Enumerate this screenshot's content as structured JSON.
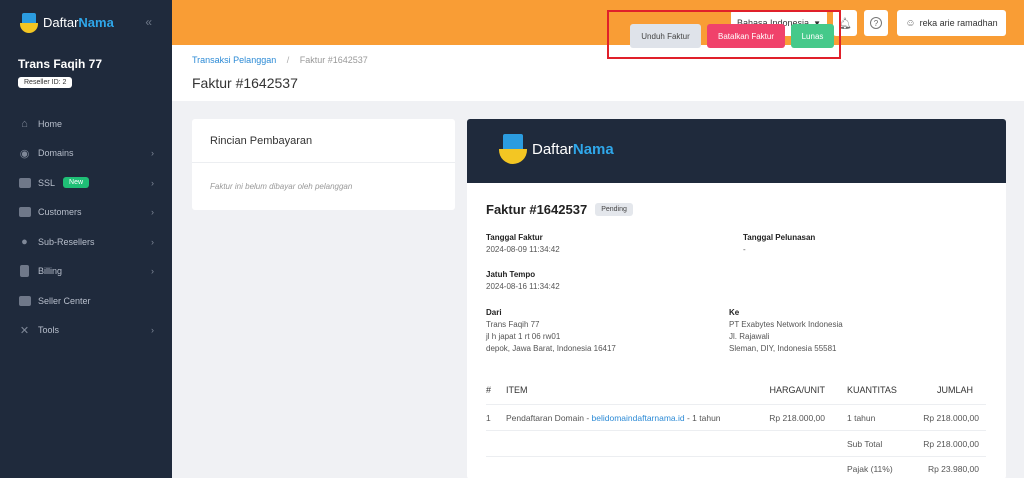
{
  "colors": {
    "sidebar": "#1f2a3c",
    "topbar": "#f99d35",
    "cancel": "#f0426b",
    "paid": "#45c98a",
    "link": "#2d8bd6"
  },
  "brand": {
    "part1": "Daftar",
    "part2": "Nama"
  },
  "sidebar": {
    "account_name": "Trans Faqih 77",
    "reseller_id": "Reseller ID: 2",
    "items": [
      {
        "label": "Home",
        "icon": "home-icon",
        "chevron": false
      },
      {
        "label": "Domains",
        "icon": "globe-icon",
        "chevron": true
      },
      {
        "label": "SSL",
        "icon": "lock-icon",
        "chevron": true,
        "badge": "New"
      },
      {
        "label": "Customers",
        "icon": "folder-icon",
        "chevron": true
      },
      {
        "label": "Sub-Resellers",
        "icon": "users-icon",
        "chevron": true
      },
      {
        "label": "Billing",
        "icon": "document-icon",
        "chevron": true
      },
      {
        "label": "Seller Center",
        "icon": "store-icon",
        "chevron": false
      },
      {
        "label": "Tools",
        "icon": "tools-icon",
        "chevron": true
      }
    ]
  },
  "topbar": {
    "language": "Bahasa Indonesia",
    "user": "reka arie ramadhan"
  },
  "header": {
    "breadcrumb_parent": "Transaksi Pelanggan",
    "breadcrumb_sep": "/",
    "breadcrumb_current": "Faktur #1642537",
    "title": "Faktur #1642537",
    "btn_download": "Unduh Faktur",
    "btn_cancel": "Batalkan Faktur",
    "btn_paid": "Lunas"
  },
  "payment": {
    "title": "Rincian Pembayaran",
    "note": "Faktur ini belum dibayar oleh pelanggan"
  },
  "invoice": {
    "title": "Faktur #1642537",
    "status": "Pending",
    "invoice_date_label": "Tanggal Faktur",
    "invoice_date": "2024-08-09 11:34:42",
    "paid_date_label": "Tanggal Pelunasan",
    "paid_date": "-",
    "due_label": "Jatuh Tempo",
    "due_date": "2024-08-16 11:34:42",
    "from_label": "Dari",
    "from_lines": [
      "Trans Faqih 77",
      "jl h japat 1 rt 06 rw01",
      "depok, Jawa Barat, Indonesia 16417"
    ],
    "to_label": "Ke",
    "to_lines": [
      "PT Exabytes Network Indonesia",
      "Jl. Rajawali",
      "Sleman, DIY, Indonesia 55581"
    ],
    "columns": {
      "no": "#",
      "item": "ITEM",
      "price": "HARGA/UNIT",
      "qty": "KUANTITAS",
      "total": "JUMLAH"
    },
    "row1": {
      "no": "1",
      "item_prefix": "Pendaftaran Domain - ",
      "item_link": "belidomaindaftarnama.id",
      "item_suffix": " - 1 tahun",
      "price": "Rp 218.000,00",
      "qty": "1 tahun",
      "total": "Rp 218.000,00"
    },
    "subtotal_label": "Sub Total",
    "subtotal": "Rp 218.000,00",
    "tax_label": "Pajak (11%)",
    "tax": "Rp 23.980,00"
  }
}
